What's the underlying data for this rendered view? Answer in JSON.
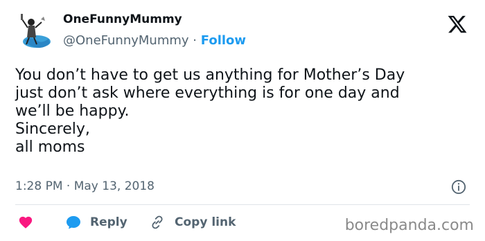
{
  "author": {
    "display_name": "OneFunnyMummy",
    "handle": "@OneFunnyMummy",
    "separator": "·",
    "follow_label": "Follow"
  },
  "tweet": {
    "lines": [
      "You don’t have to get us anything for Mother’s Day",
      "just don’t ask where everything is for one day and",
      "we’ll be happy.",
      "Sincerely,",
      "all moms"
    ],
    "timestamp": "1:28 PM · May 13, 2018"
  },
  "actions": {
    "like_icon": "heart-icon",
    "reply_label": "Reply",
    "copy_link_label": "Copy link"
  },
  "watermark": "boredpanda.com",
  "colors": {
    "accent": "#1d9bf0",
    "like": "#f91880",
    "muted": "#536471",
    "text": "#0f1419"
  }
}
